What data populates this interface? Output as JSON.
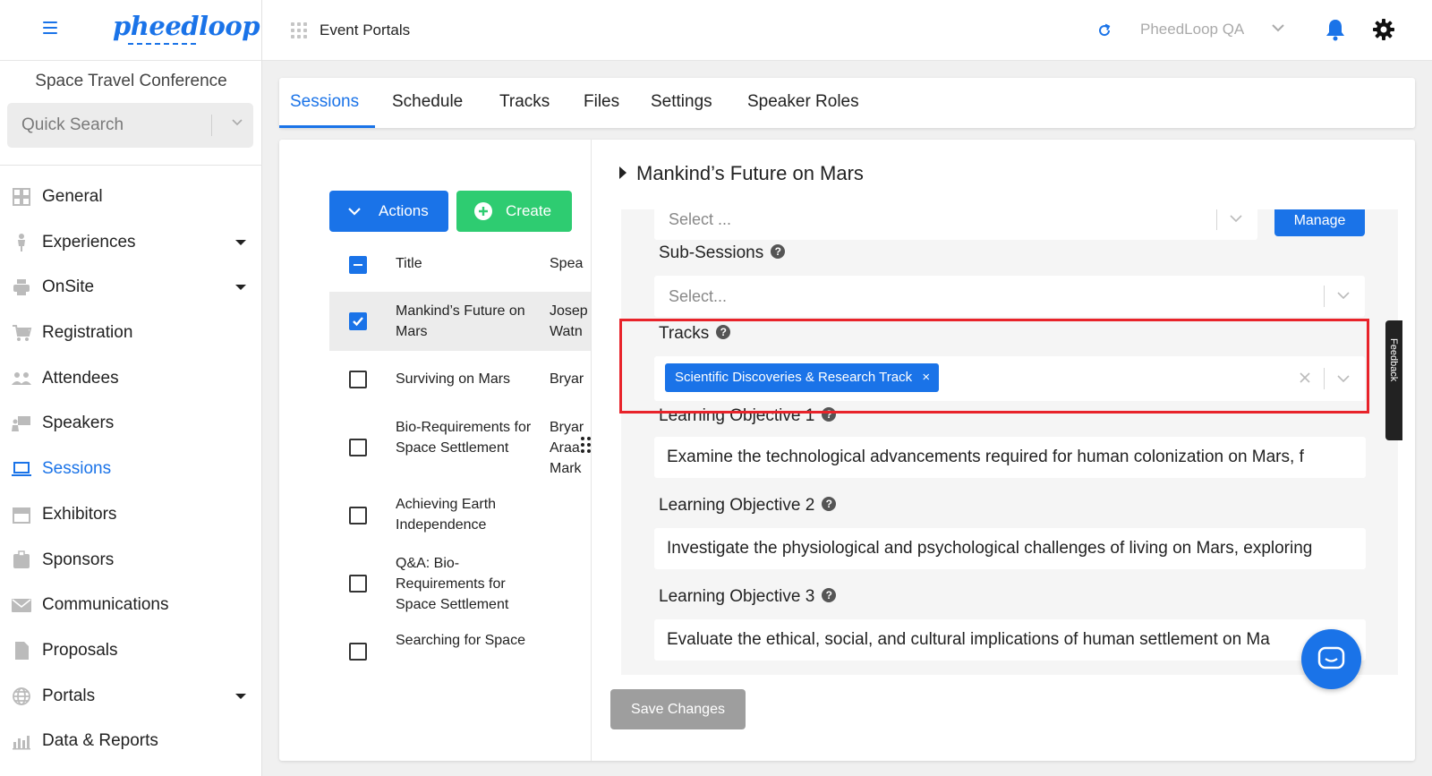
{
  "app": {
    "logo_text": "pheedloop",
    "event_name": "Space Travel Conference",
    "quick_search_placeholder": "Quick Search"
  },
  "sidebar": {
    "items": [
      {
        "label": "General",
        "icon": "grid-icon",
        "has_caret": false,
        "active": false
      },
      {
        "label": "Experiences",
        "icon": "person-icon",
        "has_caret": true,
        "active": false
      },
      {
        "label": "OnSite",
        "icon": "printer-icon",
        "has_caret": true,
        "active": false
      },
      {
        "label": "Registration",
        "icon": "cart-icon",
        "has_caret": false,
        "active": false
      },
      {
        "label": "Attendees",
        "icon": "people-icon",
        "has_caret": false,
        "active": false
      },
      {
        "label": "Speakers",
        "icon": "presenter-icon",
        "has_caret": false,
        "active": false
      },
      {
        "label": "Sessions",
        "icon": "laptop-icon",
        "has_caret": false,
        "active": true
      },
      {
        "label": "Exhibitors",
        "icon": "storefront-icon",
        "has_caret": false,
        "active": false
      },
      {
        "label": "Sponsors",
        "icon": "badge-icon",
        "has_caret": false,
        "active": false
      },
      {
        "label": "Communications",
        "icon": "envelope-icon",
        "has_caret": false,
        "active": false
      },
      {
        "label": "Proposals",
        "icon": "document-icon",
        "has_caret": false,
        "active": false
      },
      {
        "label": "Portals",
        "icon": "globe-icon",
        "has_caret": true,
        "active": false
      },
      {
        "label": "Data & Reports",
        "icon": "bar-chart-icon",
        "has_caret": false,
        "active": false
      }
    ]
  },
  "topbar": {
    "portals_label": "Event Portals",
    "org_name": "PheedLoop QA"
  },
  "tabs": [
    {
      "label": "Sessions",
      "active": true
    },
    {
      "label": "Schedule",
      "active": false
    },
    {
      "label": "Tracks",
      "active": false
    },
    {
      "label": "Files",
      "active": false
    },
    {
      "label": "Settings",
      "active": false
    },
    {
      "label": "Speaker Roles",
      "active": false
    }
  ],
  "list": {
    "actions_label": "Actions",
    "create_label": "Create",
    "columns": {
      "title": "Title",
      "speakers": "Spea"
    },
    "rows": [
      {
        "title": "Mankind’s Future on Mars",
        "speakers": "Josep\nWatn",
        "checked": true,
        "selected": true
      },
      {
        "title": "Surviving on Mars",
        "speakers": "Bryar",
        "checked": false,
        "selected": false
      },
      {
        "title": "Bio-Requirements for Space Settlement",
        "speakers": "Bryar\nAraa:\nMark",
        "checked": false,
        "selected": false
      },
      {
        "title": "Achieving Earth Independence",
        "speakers": "",
        "checked": false,
        "selected": false
      },
      {
        "title": "Q&A: Bio-Requirements for Space Settlement",
        "speakers": "",
        "checked": false,
        "selected": false
      },
      {
        "title": "Searching for Space",
        "speakers": "",
        "checked": false,
        "selected": false
      }
    ]
  },
  "detail": {
    "session_title": "Mankind’s Future on Mars",
    "top_select_placeholder": "Select ...",
    "manage_label": "Manage",
    "sub_sessions_label": "Sub-Sessions",
    "sub_sessions_placeholder": "Select...",
    "tracks_label": "Tracks",
    "track_chip": "Scientific Discoveries & Research Track",
    "lo1_label": "Learning Objective 1",
    "lo1_value": "Examine the technological advancements required for human colonization on Mars, f",
    "lo2_label": "Learning Objective 2",
    "lo2_value": "Investigate the physiological and psychological challenges of living on Mars, exploring",
    "lo3_label": "Learning Objective 3",
    "lo3_value": "Evaluate the ethical, social, and cultural implications of human settlement on Ma",
    "save_label": "Save Changes",
    "help_glyph": "?"
  },
  "side_tab_label": "Feedback",
  "colors": {
    "primary": "#1a73e8",
    "create_green": "#2ecc71",
    "highlight_red": "#e8232a",
    "save_disabled": "#9e9e9e"
  }
}
